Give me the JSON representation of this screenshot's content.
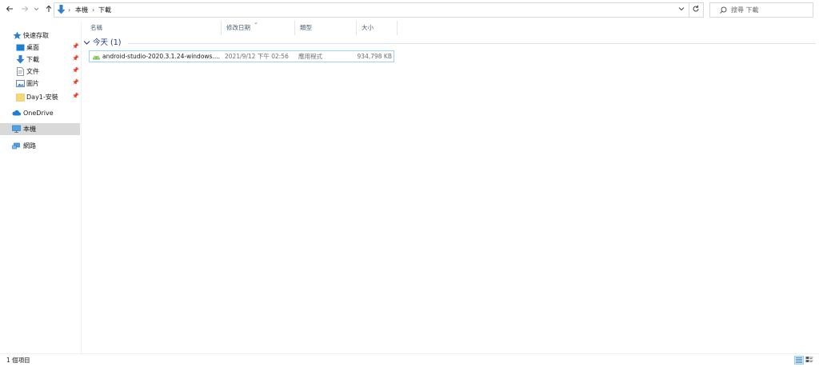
{
  "toolbar": {
    "back_icon": "arrow-left-icon",
    "forward_icon": "arrow-right-icon",
    "recent_icon": "chevron-down-icon",
    "up_icon": "arrow-up-icon",
    "breadcrumb": [
      "本機",
      "下載"
    ],
    "search_placeholder": "搜尋 下載"
  },
  "columns": [
    "名稱",
    "修改日期",
    "類型",
    "大小"
  ],
  "sidebar": {
    "items": [
      {
        "label": "快速存取",
        "icon": "star-icon"
      },
      {
        "label": "桌面",
        "icon": "desktop-icon",
        "pinned": true
      },
      {
        "label": "下載",
        "icon": "download-icon",
        "pinned": true
      },
      {
        "label": "文件",
        "icon": "document-icon",
        "pinned": true
      },
      {
        "label": "圖片",
        "icon": "pictures-icon",
        "pinned": true
      },
      {
        "label": "Day1-安裝",
        "icon": "folder-icon",
        "pinned": true
      },
      {
        "label": "OneDrive",
        "icon": "cloud-icon"
      },
      {
        "label": "本機",
        "icon": "computer-icon",
        "selected": true
      },
      {
        "label": "網路",
        "icon": "network-icon"
      }
    ]
  },
  "group": {
    "label": "今天 (1)"
  },
  "files": [
    {
      "name": "android-studio-2020.3.1.24-windows....",
      "modified": "2021/9/12 下午 02:56",
      "type": "應用程式",
      "size": "934,798 KB",
      "icon": "android-app-icon"
    }
  ],
  "status": {
    "item_count": "1 個項目"
  },
  "colors": {
    "accent": "#0078d7",
    "selection_border": "#99d1ff",
    "group_text": "#1e3287"
  }
}
